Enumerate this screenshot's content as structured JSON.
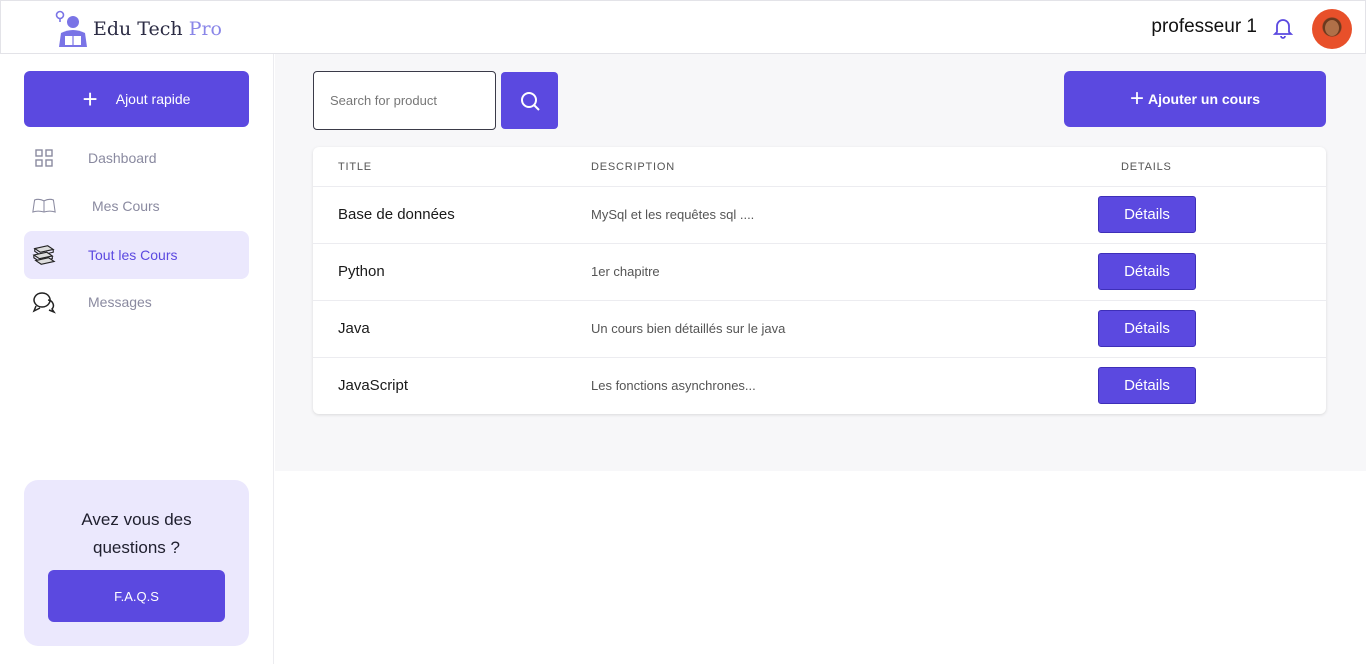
{
  "header": {
    "logo_text": "Edu Tech",
    "logo_suffix": "Pro",
    "user_name": "professeur 1"
  },
  "sidebar": {
    "quick_add_label": "Ajout rapide",
    "items": [
      {
        "label": "Dashboard",
        "icon": "grid-icon",
        "active": false
      },
      {
        "label": "Mes Cours",
        "icon": "open-book-icon",
        "active": false
      },
      {
        "label": "Tout les Cours",
        "icon": "books-stack-icon",
        "active": true
      },
      {
        "label": "Messages",
        "icon": "chat-bubbles-icon",
        "active": false
      }
    ],
    "faq": {
      "title": "Avez vous des questions ?",
      "button_label": "F.A.Q.S"
    }
  },
  "main": {
    "search": {
      "placeholder": "Search for product",
      "value": ""
    },
    "add_course_label": "Ajouter un cours",
    "table": {
      "headers": {
        "title": "TITLE",
        "description": "DESCRIPTION",
        "details": "DETAILS"
      },
      "rows": [
        {
          "title": "Base de données",
          "description": "MySql et les requêtes sql ....",
          "button": "Détails"
        },
        {
          "title": "Python",
          "description": "1er chapitre",
          "button": "Détails"
        },
        {
          "title": "Java",
          "description": "Un cours bien détaillés sur le java",
          "button": "Détails"
        },
        {
          "title": "JavaScript",
          "description": "Les fonctions asynchrones...",
          "button": "Détails"
        }
      ]
    }
  },
  "colors": {
    "accent": "#5b49e0",
    "active_bg": "#ebe8fd",
    "main_bg": "#f7f7f9"
  }
}
